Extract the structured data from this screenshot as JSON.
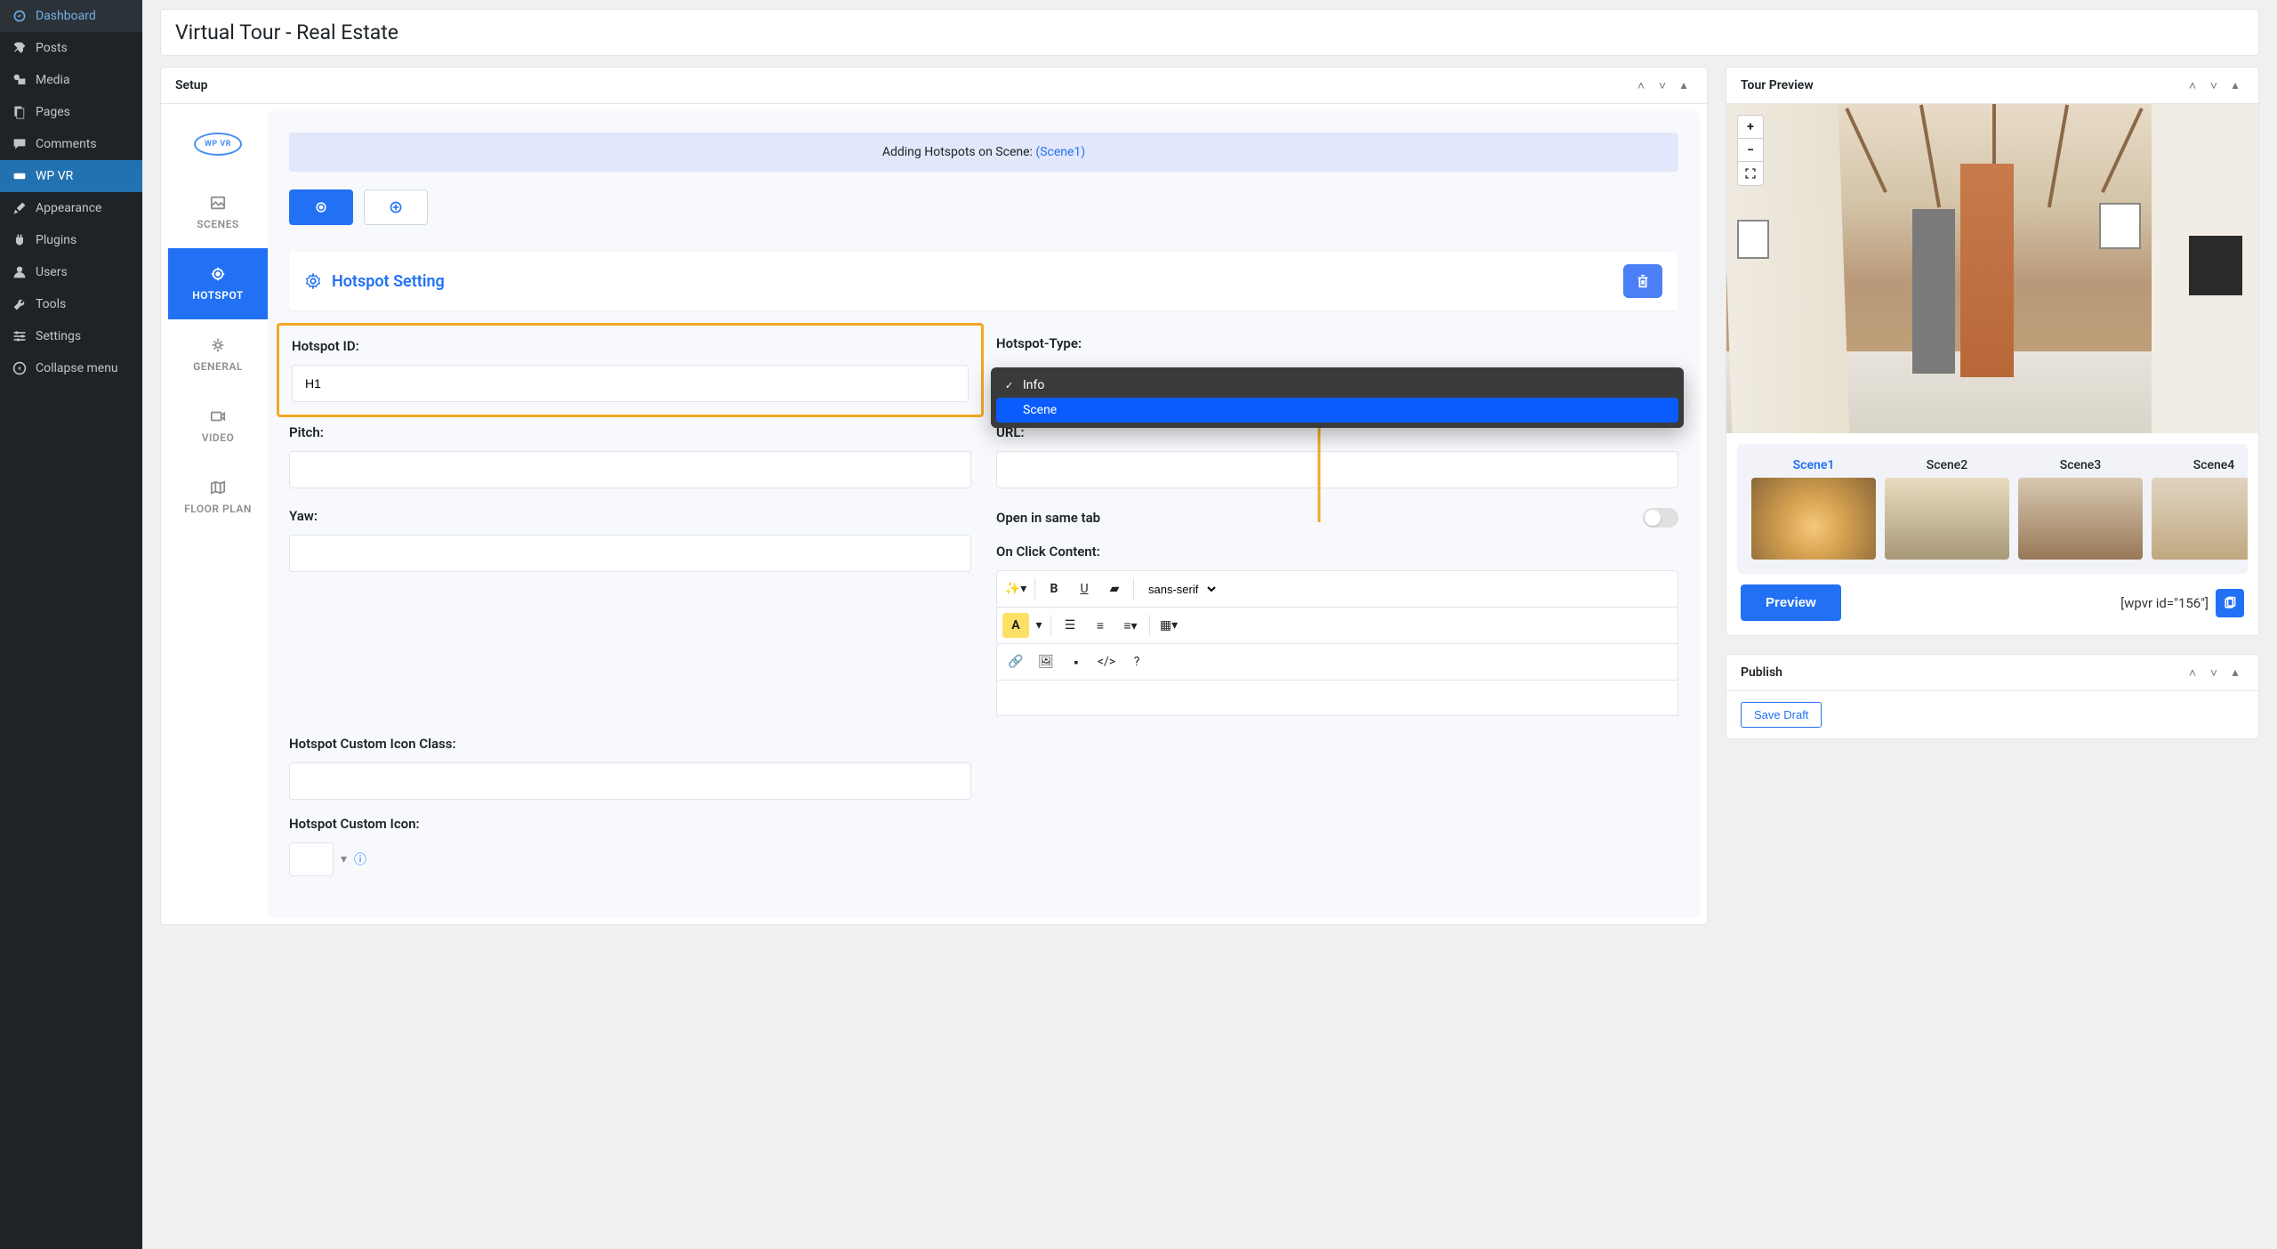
{
  "sidebar": {
    "items": [
      {
        "label": "Dashboard",
        "icon": "dashboard"
      },
      {
        "label": "Posts",
        "icon": "pin"
      },
      {
        "label": "Media",
        "icon": "media"
      },
      {
        "label": "Pages",
        "icon": "pages"
      },
      {
        "label": "Comments",
        "icon": "comments"
      },
      {
        "label": "WP VR",
        "icon": "wpvr",
        "active": true
      },
      {
        "label": "Appearance",
        "icon": "brush"
      },
      {
        "label": "Plugins",
        "icon": "plug"
      },
      {
        "label": "Users",
        "icon": "users"
      },
      {
        "label": "Tools",
        "icon": "tools"
      },
      {
        "label": "Settings",
        "icon": "settings"
      }
    ],
    "collapse": "Collapse menu"
  },
  "page_title": "Virtual Tour - Real Estate",
  "setup": {
    "title": "Setup",
    "logo": "WP VR",
    "tabs": [
      {
        "label": "SCENES",
        "icon": "image"
      },
      {
        "label": "HOTSPOT",
        "icon": "target",
        "active": true
      },
      {
        "label": "GENERAL",
        "icon": "gear"
      },
      {
        "label": "VIDEO",
        "icon": "video"
      },
      {
        "label": "FLOOR PLAN",
        "icon": "map"
      }
    ],
    "banner_prefix": "Adding Hotspots on Scene: ",
    "banner_scene": "(Scene1)",
    "setting_title": "Hotspot Setting",
    "fields": {
      "hotspot_id_label": "Hotspot ID:",
      "hotspot_id_value": "H1",
      "hotspot_type_label": "Hotspot-Type:",
      "hotspot_type_options": [
        "Info",
        "Scene"
      ],
      "hotspot_type_selected": "Info",
      "pitch_label": "Pitch:",
      "pitch_value": "",
      "url_label": "URL:",
      "url_value": "",
      "yaw_label": "Yaw:",
      "yaw_value": "",
      "same_tab_label": "Open in same tab",
      "onclick_label": "On Click Content:",
      "icon_class_label": "Hotspot Custom Icon Class:",
      "icon_class_value": "",
      "custom_icon_label": "Hotspot Custom Icon:",
      "font_family": "sans-serif"
    }
  },
  "preview": {
    "title": "Tour Preview",
    "scenes": [
      "Scene1",
      "Scene2",
      "Scene3",
      "Scene4"
    ],
    "active_scene": "Scene1",
    "preview_btn": "Preview",
    "shortcode": "[wpvr id=\"156\"]"
  },
  "publish": {
    "title": "Publish",
    "save_draft": "Save Draft"
  }
}
